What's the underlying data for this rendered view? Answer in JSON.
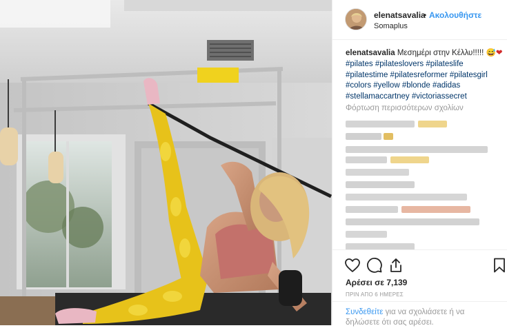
{
  "post": {
    "username": "elenatsavalia",
    "separator": "•",
    "follow_label": "Ακολουθήστε",
    "location": "Somaplus",
    "caption": {
      "username": "elenatsavalia",
      "text": "Μεσημέρι στην Κέλλυ!!!!!",
      "emojis": "😅❤",
      "hashtags_line1": "#pilates #pilateslovers #pilateslife",
      "hashtags_line2": "#pilatestime #pilatesreformer #pilatesgirl",
      "hashtags_line3": "#colors #yellow #blonde #adidas",
      "hashtags_line4": "#stellamaccartney #victoriassecret"
    },
    "load_more_label": "Φόρτωση περισσότερων σχολίων",
    "likes_text": "Αρέσει σε 7,139",
    "time_text": "ΠΡΙΝ ΑΠΟ 6 ΗΜΕΡΕΣ",
    "add_comment": {
      "link": "Συνδεθείτε",
      "text": " για να σχολιάσετε ή να δηλώσετε ότι σας αρέσει."
    }
  },
  "icons": {
    "like": "heart-icon",
    "comment": "comment-bubble-icon",
    "share": "share-icon",
    "save": "bookmark-icon"
  },
  "colors": {
    "link": "#3897f0",
    "hashtag": "#003569",
    "muted": "#999999",
    "text": "#262626"
  }
}
